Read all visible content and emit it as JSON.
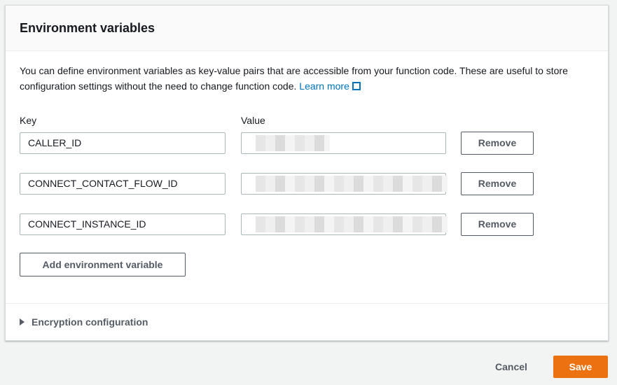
{
  "panel": {
    "title": "Environment variables",
    "description": "You can define environment variables as key-value pairs that are accessible from your function code. These are useful to store configuration settings without the need to change function code.",
    "learn_more": "Learn more",
    "key_label": "Key",
    "value_label": "Value",
    "variables": [
      {
        "key": "CALLER_ID",
        "value": "",
        "remove": "Remove"
      },
      {
        "key": "CONNECT_CONTACT_FLOW_ID",
        "value": "",
        "remove": "Remove"
      },
      {
        "key": "CONNECT_INSTANCE_ID",
        "value": "",
        "remove": "Remove"
      }
    ],
    "add_label": "Add environment variable",
    "encryption_label": "Encryption configuration"
  },
  "footer": {
    "cancel": "Cancel",
    "save": "Save"
  },
  "colors": {
    "accent": "#ec7211",
    "link": "#0073bb"
  }
}
